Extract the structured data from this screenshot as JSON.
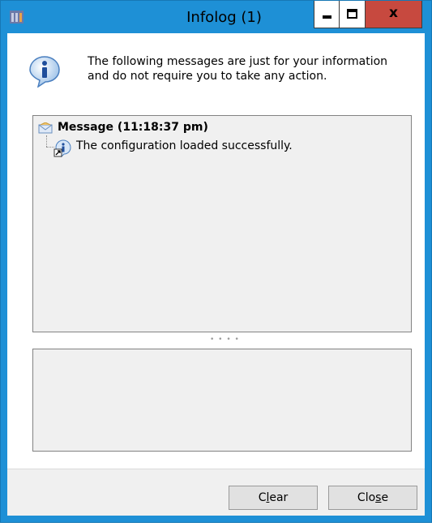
{
  "window": {
    "title": "Infolog (1)",
    "controls": {
      "minimize": "minimize",
      "maximize": "maximize",
      "close_glyph": "x"
    },
    "colors": {
      "titlebar": "#1E90D6",
      "close_button": "#C7493F",
      "panel_bg": "#F0F0F0"
    }
  },
  "intro": {
    "text": "The following messages are just for your information and do not require you to take any action.",
    "icon": "info-icon"
  },
  "tree": {
    "header": {
      "label": "Message (11:18:37 pm)",
      "icon": "envelope-icon"
    },
    "items": [
      {
        "text": "The configuration loaded successfully.",
        "icon": "info-icon"
      }
    ]
  },
  "details": {
    "text": ""
  },
  "buttons": {
    "clear": {
      "pre": "C",
      "accel": "l",
      "post": "ear"
    },
    "close": {
      "pre": "Clo",
      "accel": "s",
      "post": "e"
    }
  }
}
